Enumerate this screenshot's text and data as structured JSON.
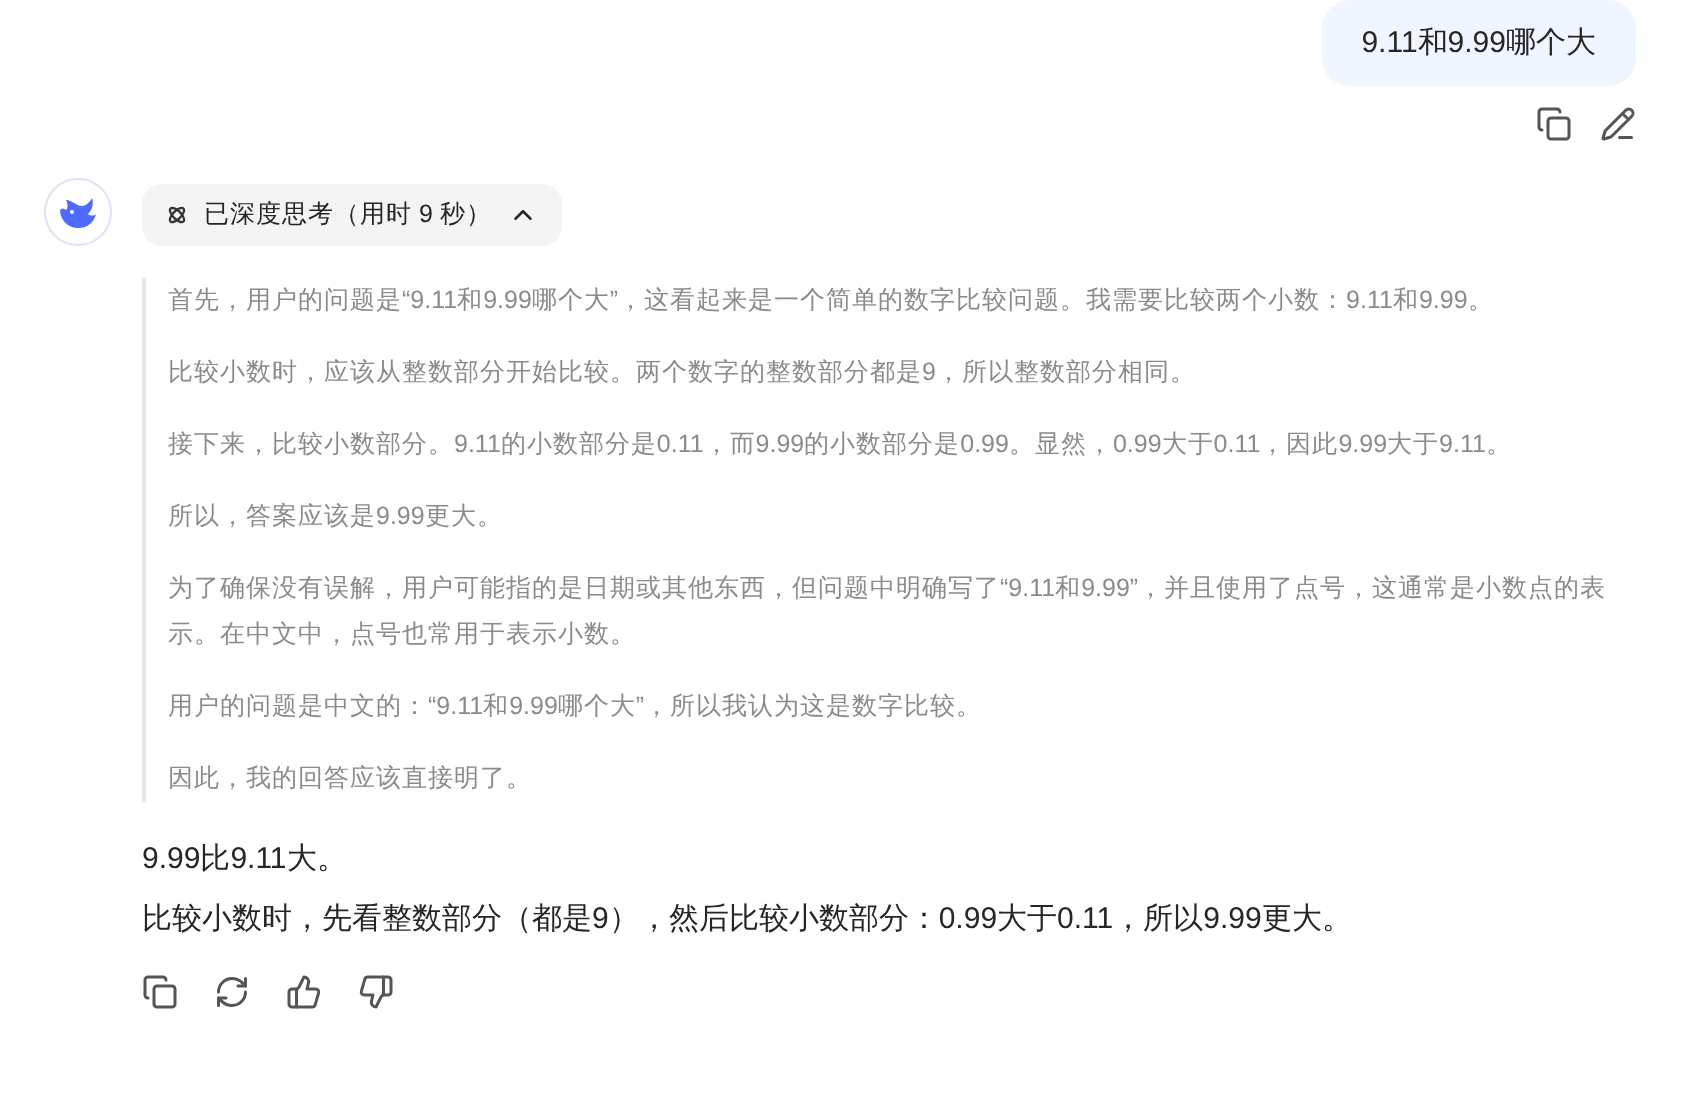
{
  "user_message": {
    "text": "9.11和9.99哪个大"
  },
  "thinking": {
    "label": "已深度思考（用时 9 秒）",
    "expanded": true,
    "paragraphs": [
      "首先，用户的问题是“9.11和9.99哪个大”，这看起来是一个简单的数字比较问题。我需要比较两个小数：9.11和9.99。",
      "比较小数时，应该从整数部分开始比较。两个数字的整数部分都是9，所以整数部分相同。",
      "接下来，比较小数部分。9.11的小数部分是0.11，而9.99的小数部分是0.99。显然，0.99大于0.11，因此9.99大于9.11。",
      "所以，答案应该是9.99更大。",
      "为了确保没有误解，用户可能指的是日期或其他东西，但问题中明确写了“9.11和9.99”，并且使用了点号，这通常是小数点的表示。在中文中，点号也常用于表示小数。",
      "用户的问题是中文的：“9.11和9.99哪个大”，所以我认为这是数字比较。",
      "因此，我的回答应该直接明了。"
    ]
  },
  "answer": [
    "9.99比9.11大。",
    "比较小数时，先看整数部分（都是9），然后比较小数部分：0.99大于0.11，所以9.99更大。"
  ]
}
